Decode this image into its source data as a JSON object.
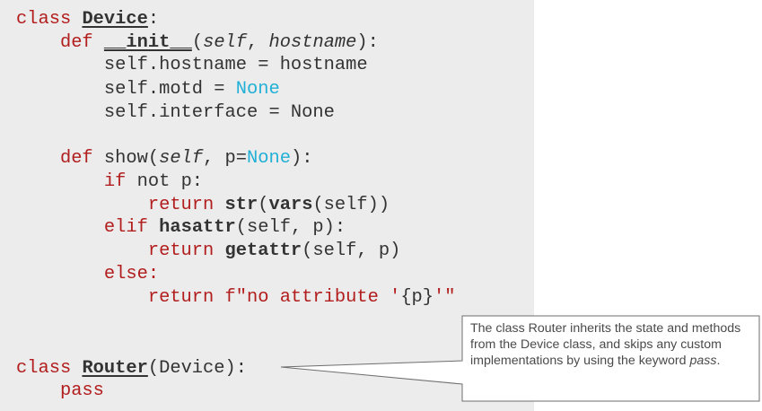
{
  "code": {
    "device": {
      "kw_class": "class",
      "name": "Device",
      "colon": ":"
    },
    "init": {
      "kw_def": "def",
      "name": "__init__",
      "open": "(",
      "self": "self",
      "comma": ", ",
      "param": "hostname",
      "close": "):"
    },
    "assign_hostname": "self.hostname = hostname",
    "assign_motd": {
      "lhs": "self.motd = ",
      "value": "None"
    },
    "assign_interface": "self.interface = None",
    "show": {
      "kw_def": "def",
      "name": "show(",
      "self": "self",
      "mid": ", p=",
      "default": "None",
      "close": "):"
    },
    "if_line": {
      "kw_if": "if",
      "rest": " not p:"
    },
    "return1": {
      "kw_return": "return",
      "fn1": "str",
      "open1": "(",
      "fn2": "vars",
      "rest": "(self))"
    },
    "elif_line": {
      "kw_elif": "elif",
      "fn": "hasattr",
      "rest": "(self, p):"
    },
    "return2": {
      "kw_return": "return",
      "fn": "getattr",
      "rest": "(self, p)"
    },
    "else_line": {
      "kw_else": "else:"
    },
    "return3": {
      "kw_return": "return",
      "fstring": "f\"no attribute '",
      "placeholder": "{p}",
      "end": "'\""
    },
    "router": {
      "kw_class": "class",
      "name": "Router",
      "rest": "(Device):"
    },
    "pass_line": {
      "kw_pass": "pass"
    }
  },
  "callout": {
    "text_main": "The class Router inherits the state and methods from the Device class, and skips any custom implementations by using the keyword ",
    "text_em": "pass",
    "text_end": "."
  },
  "colors": {
    "keyword": "#b21d1d",
    "none_literal": "#22b0d6",
    "code_default": "#333333",
    "panel_bg": "#ececec"
  }
}
